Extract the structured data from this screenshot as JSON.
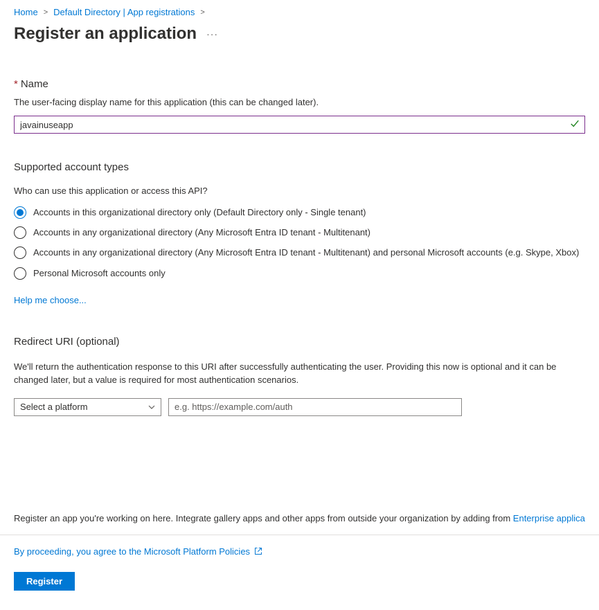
{
  "breadcrumb": {
    "home": "Home",
    "dir": "Default Directory | App registrations"
  },
  "page_title": "Register an application",
  "name_section": {
    "label": "Name",
    "desc": "The user-facing display name for this application (this can be changed later).",
    "value": "javainuseapp"
  },
  "account_types": {
    "heading": "Supported account types",
    "sub": "Who can use this application or access this API?",
    "options": [
      "Accounts in this organizational directory only (Default Directory only - Single tenant)",
      "Accounts in any organizational directory (Any Microsoft Entra ID tenant - Multitenant)",
      "Accounts in any organizational directory (Any Microsoft Entra ID tenant - Multitenant) and personal Microsoft accounts (e.g. Skype, Xbox)",
      "Personal Microsoft accounts only"
    ],
    "help_link": "Help me choose..."
  },
  "redirect": {
    "heading": "Redirect URI (optional)",
    "desc": "We'll return the authentication response to this URI after successfully authenticating the user. Providing this now is optional and it can be changed later, but a value is required for most authentication scenarios.",
    "select_placeholder": "Select a platform",
    "uri_placeholder": "e.g. https://example.com/auth"
  },
  "note": {
    "text": "Register an app you're working on here. Integrate gallery apps and other apps from outside your organization by adding from ",
    "link": "Enterprise application"
  },
  "footer": {
    "policy": "By proceeding, you agree to the Microsoft Platform Policies",
    "register_btn": "Register"
  }
}
